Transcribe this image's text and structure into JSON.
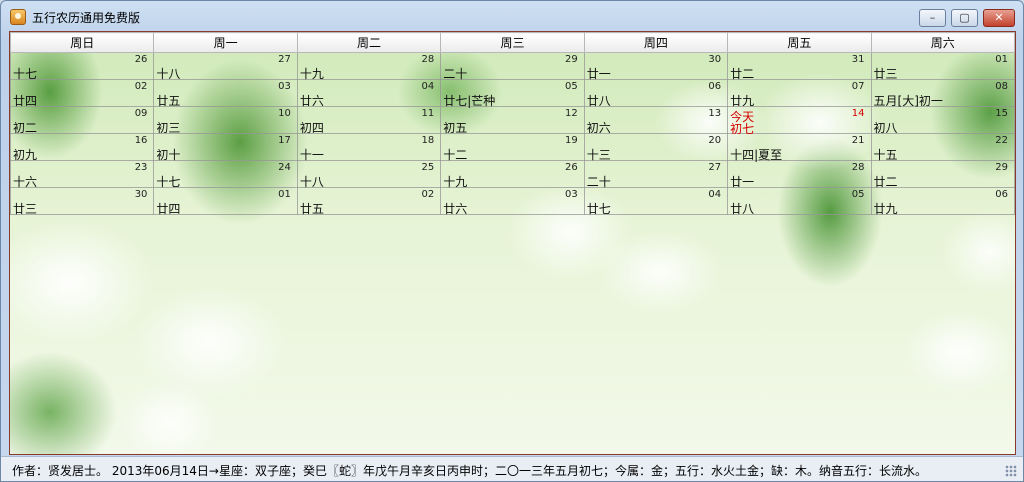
{
  "window": {
    "title": "五行农历通用免费版"
  },
  "controls": {
    "minimize": "–",
    "maximize": "▢",
    "close": "✕"
  },
  "calendar": {
    "weekdays": [
      "周日",
      "周一",
      "周二",
      "周三",
      "周四",
      "周五",
      "周六"
    ],
    "weeks": [
      [
        {
          "day": "26",
          "lunar": "十七"
        },
        {
          "day": "27",
          "lunar": "十八"
        },
        {
          "day": "28",
          "lunar": "十九"
        },
        {
          "day": "29",
          "lunar": "二十"
        },
        {
          "day": "30",
          "lunar": "廿一"
        },
        {
          "day": "31",
          "lunar": "廿二"
        },
        {
          "day": "01",
          "lunar": "廿三"
        }
      ],
      [
        {
          "day": "02",
          "lunar": "廿四"
        },
        {
          "day": "03",
          "lunar": "廿五"
        },
        {
          "day": "04",
          "lunar": "廿六"
        },
        {
          "day": "05",
          "lunar": "廿七|芒种"
        },
        {
          "day": "06",
          "lunar": "廿八"
        },
        {
          "day": "07",
          "lunar": "廿九"
        },
        {
          "day": "08",
          "lunar": "五月[大]初一"
        }
      ],
      [
        {
          "day": "09",
          "lunar": "初二"
        },
        {
          "day": "10",
          "lunar": "初三"
        },
        {
          "day": "11",
          "lunar": "初四"
        },
        {
          "day": "12",
          "lunar": "初五"
        },
        {
          "day": "13",
          "lunar": "初六"
        },
        {
          "day": "14",
          "lunar": "初七",
          "today_label": "今天"
        },
        {
          "day": "15",
          "lunar": "初八"
        }
      ],
      [
        {
          "day": "16",
          "lunar": "初九"
        },
        {
          "day": "17",
          "lunar": "初十"
        },
        {
          "day": "18",
          "lunar": "十一"
        },
        {
          "day": "19",
          "lunar": "十二"
        },
        {
          "day": "20",
          "lunar": "十三"
        },
        {
          "day": "21",
          "lunar": "十四|夏至"
        },
        {
          "day": "22",
          "lunar": "十五"
        }
      ],
      [
        {
          "day": "23",
          "lunar": "十六"
        },
        {
          "day": "24",
          "lunar": "十七"
        },
        {
          "day": "25",
          "lunar": "十八"
        },
        {
          "day": "26",
          "lunar": "十九"
        },
        {
          "day": "27",
          "lunar": "二十"
        },
        {
          "day": "28",
          "lunar": "廿一"
        },
        {
          "day": "29",
          "lunar": "廿二"
        }
      ],
      [
        {
          "day": "30",
          "lunar": "廿三"
        },
        {
          "day": "01",
          "lunar": "廿四"
        },
        {
          "day": "02",
          "lunar": "廿五"
        },
        {
          "day": "03",
          "lunar": "廿六"
        },
        {
          "day": "04",
          "lunar": "廿七"
        },
        {
          "day": "05",
          "lunar": "廿八"
        },
        {
          "day": "06",
          "lunar": "廿九"
        }
      ]
    ],
    "today_color": "#d40000"
  },
  "status": {
    "text": "作者：贤发居士。  2013年06月14日→星座：双子座；癸巳〖蛇〗年戊午月辛亥日丙申时；二〇一三年五月初七；今属：金；五行：水火土金；缺：木。纳音五行：长流水。"
  }
}
